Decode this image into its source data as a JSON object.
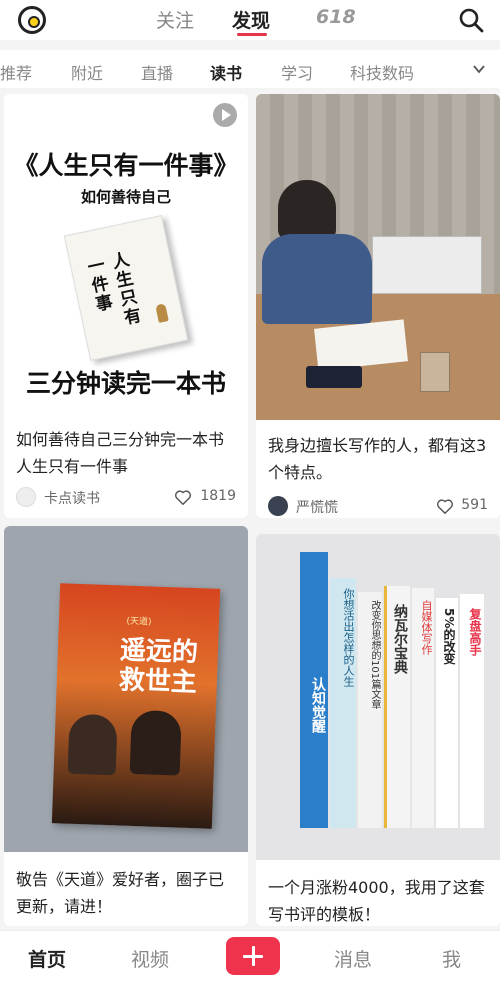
{
  "header": {
    "tabs": [
      "关注",
      "发现",
      "618"
    ],
    "active_tab": "发现"
  },
  "categories": {
    "items": [
      "推荐",
      "附近",
      "直播",
      "读书",
      "学习",
      "科技数码"
    ],
    "active": "读书"
  },
  "cards": [
    {
      "cover_title": "《人生只有一件事》",
      "cover_subtitle": "如何善待自己",
      "cover_bottom": "三分钟读完一本书",
      "book_spine_text": "人生只有一件事",
      "title": "如何善待自己三分钟完一本书人生只有一件事",
      "author": "卡点读书",
      "likes": "1819"
    },
    {
      "title": "我身边擅长写作的人，都有这3个特点。",
      "author": "严慌慌",
      "likes": "591"
    },
    {
      "book_title": "遥远的救世主",
      "book_top_text": "(天道)",
      "title": "敬告《天道》爱好者，圈子已更新，请进！"
    },
    {
      "book_spines": [
        "认知觉醒",
        "你想活出怎样的人生",
        "改变你思想的101篇文章",
        "纳瓦尔宝典",
        "自媒体写作",
        "5%的改变",
        "复盘高手"
      ],
      "title": "一个月涨粉4000，我用了这套写书评的模板！"
    }
  ],
  "bottom_nav": {
    "items": [
      "首页",
      "视频",
      "消息",
      "我"
    ],
    "active": "首页"
  },
  "colors": {
    "accent": "#e8344a",
    "plus": "#f0334d"
  }
}
